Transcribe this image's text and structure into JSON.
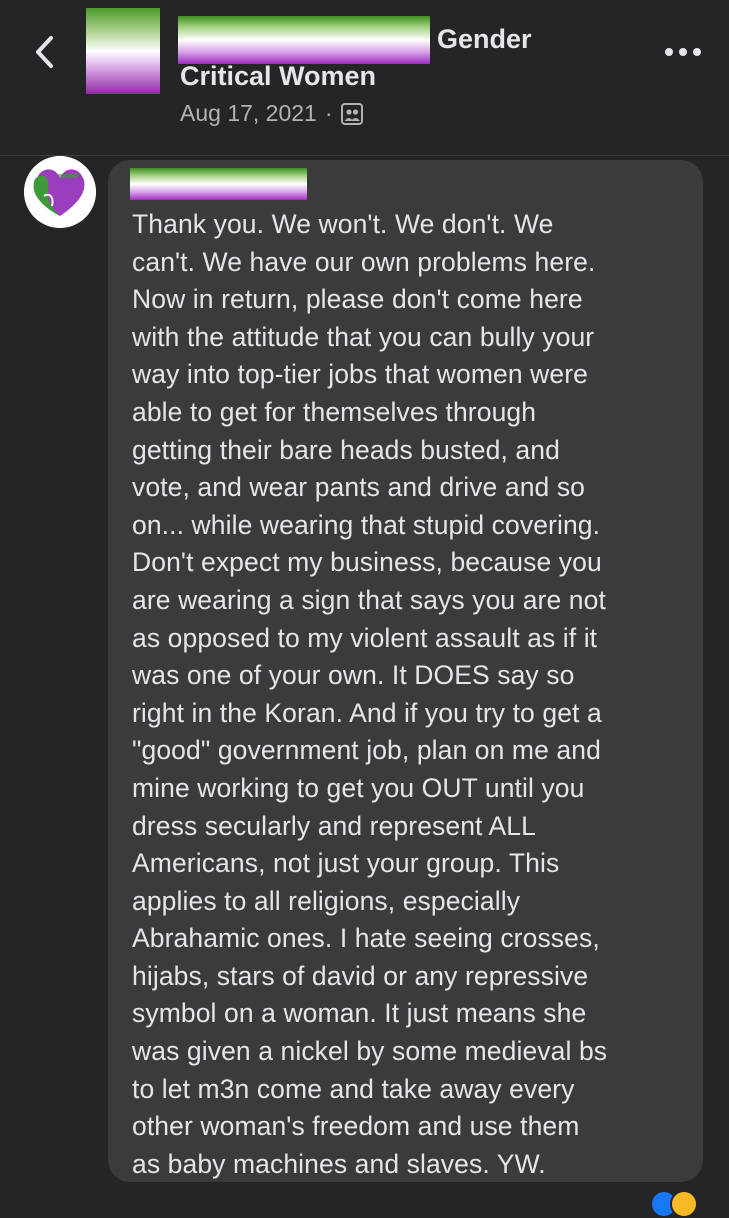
{
  "header": {
    "back_icon": "chevron-left-icon",
    "group_name_line1_suffix": "Gender",
    "group_name_line2": "Critical Women",
    "date": "Aug 17, 2021",
    "separator": "·",
    "audience_icon": "group-members-icon",
    "more_icon": "more-dots-icon"
  },
  "comment": {
    "avatar_icon": "group-logo-avatar",
    "text": "Thank you. We won't. We don't. We\ncan't. We have our own problems here.\nNow in return, please don't come here\nwith the attitude that you can bully your\nway into top-tier jobs that women were\nable to get for themselves through\ngetting their bare heads busted, and\nvote, and wear pants and drive and so\non... while wearing that stupid covering.\nDon't expect my business, because you\nare wearing a sign that says you are not\nas opposed to my violent assault as if it\nwas one of your own. It DOES say so\nright in the Koran. And if you try to get a\n\"good\" government job, plan on me and\nmine working to get you OUT until you\ndress secularly and represent ALL\nAmericans, not just your group. This\napplies to all religions, especially\nAbrahamic ones. I hate seeing crosses,\nhijabs, stars of david or any repressive\nsymbol on a woman. It just means she\nwas given a nickel by some medieval bs\nto let m3n come and take away every\nother woman's freedom and use them\nas baby machines and slaves. YW."
  },
  "colors": {
    "background": "#242526",
    "bubble": "#3a3b3c",
    "text": "#e4e6eb",
    "meta_text": "#b0b3b8",
    "flag_green": "#4c9a2a",
    "flag_purple": "#8e2da0"
  }
}
